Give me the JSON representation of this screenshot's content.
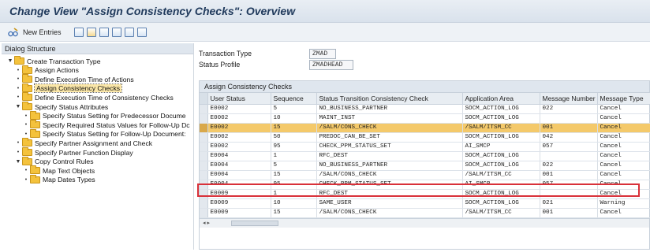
{
  "window": {
    "title": "Change View \"Assign Consistency Checks\": Overview"
  },
  "toolbar": {
    "new_entries_label": "New Entries",
    "icons": [
      "edit-glasses-icon",
      "copy-icon",
      "copy-as-icon",
      "undo-icon",
      "select-all-icon",
      "select-block-icon",
      "deselect-all-icon"
    ]
  },
  "left_panel": {
    "header": "Dialog Structure",
    "tree": [
      {
        "label": "Create Transaction Type",
        "level": 0,
        "marker": "▼"
      },
      {
        "label": "Assign Actions",
        "level": 1,
        "marker": "•"
      },
      {
        "label": "Define Execution Time of Actions",
        "level": 1,
        "marker": "•"
      },
      {
        "label": "Assign Consistency Checks",
        "level": 1,
        "marker": "•",
        "selected": true
      },
      {
        "label": "Define Execution Time of Consistency Checks",
        "level": 1,
        "marker": "•"
      },
      {
        "label": "Specify Status Attributes",
        "level": 1,
        "marker": "▼"
      },
      {
        "label": "Specify Status Setting for Predecessor Docume",
        "level": 2,
        "marker": "•"
      },
      {
        "label": "Specify Required Status Values for Follow-Up Dc",
        "level": 2,
        "marker": "•"
      },
      {
        "label": "Specify Status Setting for Follow-Up Document:",
        "level": 2,
        "marker": "•"
      },
      {
        "label": "Specify Partner Assignment and Check",
        "level": 1,
        "marker": "•"
      },
      {
        "label": "Specify Partner Function Display",
        "level": 1,
        "marker": "•"
      },
      {
        "label": "Copy Control Rules",
        "level": 1,
        "marker": "▼"
      },
      {
        "label": "Map Text Objects",
        "level": 2,
        "marker": "•"
      },
      {
        "label": "Map Dates Types",
        "level": 2,
        "marker": "•"
      }
    ]
  },
  "header_fields": {
    "transaction_type_label": "Transaction Type",
    "transaction_type_value": "ZMAD",
    "status_profile_label": "Status Profile",
    "status_profile_value": "ZMADHEAD"
  },
  "table": {
    "caption": "Assign Consistency Checks",
    "columns": [
      "User Status",
      "Sequence",
      "Status Transition Consistency Check",
      "Application Area",
      "Message Number",
      "Message Type"
    ],
    "rows": [
      [
        "E0002",
        "5",
        "NO_BUSINESS_PARTNER",
        "SOCM_ACTION_LOG",
        "022",
        "Cancel"
      ],
      [
        "E0002",
        "10",
        "MAINT_INST",
        "SOCM_ACTION_LOG",
        "",
        "Cancel"
      ],
      [
        "E0002",
        "15",
        "/SALM/CONS_CHECK",
        "/SALM/ITSM_CC",
        "001",
        "Cancel"
      ],
      [
        "E0002",
        "50",
        "PREDOC_CAN_BE_SET",
        "SOCM_ACTION_LOG",
        "042",
        "Cancel"
      ],
      [
        "E0002",
        "95",
        "CHECK_PPM_STATUS_SET",
        "AI_SMCP",
        "057",
        "Cancel"
      ],
      [
        "E0004",
        "1",
        "RFC_DEST",
        "SOCM_ACTION_LOG",
        "",
        "Cancel"
      ],
      [
        "E0004",
        "5",
        "NO_BUSINESS_PARTNER",
        "SOCM_ACTION_LOG",
        "022",
        "Cancel"
      ],
      [
        "E0004",
        "15",
        "/SALM/CONS_CHECK",
        "/SALM/ITSM_CC",
        "001",
        "Cancel"
      ],
      [
        "E0004",
        "95",
        "CHECK_PPM_STATUS_SET",
        "AI_SMCP",
        "057",
        "Cancel"
      ],
      [
        "E0009",
        "1",
        "RFC_DEST",
        "SOCM_ACTION_LOG",
        "",
        "Cancel"
      ],
      [
        "E0009",
        "10",
        "SAME_USER",
        "SOCM_ACTION_LOG",
        "021",
        "Warning"
      ],
      [
        "E0009",
        "15",
        "/SALM/CONS_CHECK",
        "/SALM/ITSM_CC",
        "001",
        "Cancel"
      ]
    ],
    "highlighted_row_index": 2,
    "boxed_row_index": 7
  },
  "colors": {
    "highlight_row": "#f4c96a",
    "red_box": "#d9313a",
    "title_text": "#203a5c"
  }
}
